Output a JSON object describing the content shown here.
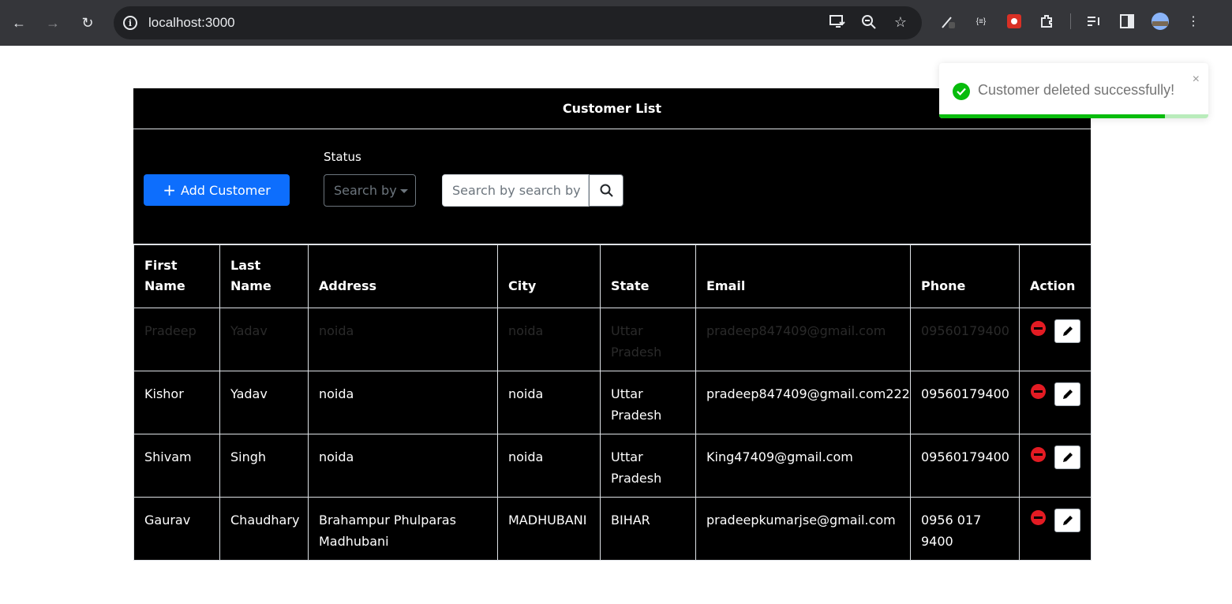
{
  "browser": {
    "url": "localhost:3000"
  },
  "page": {
    "title": "Customer List",
    "add_button_label": "Add Customer",
    "status_label": "Status",
    "status_select_value": "Search by",
    "search_placeholder": "Search by search by"
  },
  "table": {
    "headers": [
      "First Name",
      "Last Name",
      "Address",
      "City",
      "State",
      "Email",
      "Phone",
      "Action"
    ],
    "rows": [
      {
        "first": "Pradeep",
        "last": "Yadav",
        "address": "noida",
        "city": "noida",
        "state": "Uttar Pradesh",
        "email": "pradeep847409@gmail.com",
        "phone": "09560179400",
        "faded": true
      },
      {
        "first": "Kishor",
        "last": "Yadav",
        "address": "noida",
        "city": "noida",
        "state": "Uttar Pradesh",
        "email": "pradeep847409@gmail.com222",
        "phone": "09560179400",
        "faded": false
      },
      {
        "first": "Shivam",
        "last": "Singh",
        "address": "noida",
        "city": "noida",
        "state": "Uttar Pradesh",
        "email": "King47409@gmail.com",
        "phone": "09560179400",
        "faded": false
      },
      {
        "first": "Gaurav",
        "last": "Chaudhary",
        "address": "Brahampur Phulparas Madhubani",
        "city": "MADHUBANI",
        "state": "BIHAR",
        "email": "pradeepkumarjse@gmail.com",
        "phone": "0956 017 9400",
        "faded": false
      }
    ]
  },
  "toast": {
    "message": "Customer deleted successfully!",
    "close_glyph": "×",
    "progress": 0.84,
    "color": "#07bc0c"
  },
  "colors": {
    "primary": "#0d6efd",
    "delete": "#e31b23"
  }
}
